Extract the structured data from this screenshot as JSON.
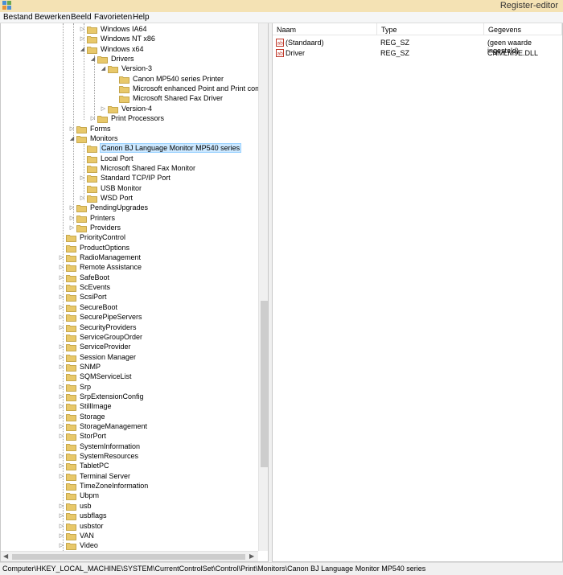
{
  "window": {
    "title": "Register-editor"
  },
  "menu": [
    "Bestand",
    "Bewerken",
    "Beeld",
    "Favorieten",
    "Help"
  ],
  "tree": [
    {
      "label": "Windows IA64",
      "expander": "collapsed"
    },
    {
      "label": "Windows NT x86",
      "expander": "collapsed"
    },
    {
      "label": "Windows x64",
      "expander": "expanded"
    },
    {
      "label": "Drivers",
      "expander": "expanded"
    },
    {
      "label": "Version-3",
      "expander": "expanded"
    },
    {
      "label": "Canon MP540 series Printer",
      "expander": "none"
    },
    {
      "label": "Microsoft enhanced Point and Print compat",
      "expander": "none"
    },
    {
      "label": "Microsoft Shared Fax Driver",
      "expander": "none"
    },
    {
      "label": "Version-4",
      "expander": "collapsed"
    },
    {
      "label": "Print Processors",
      "expander": "collapsed"
    },
    {
      "label": "Forms",
      "expander": "collapsed"
    },
    {
      "label": "Monitors",
      "expander": "expanded"
    },
    {
      "label": "Canon BJ Language Monitor MP540 series",
      "expander": "none",
      "selected": true
    },
    {
      "label": "Local Port",
      "expander": "none"
    },
    {
      "label": "Microsoft Shared Fax Monitor",
      "expander": "none"
    },
    {
      "label": "Standard TCP/IP Port",
      "expander": "collapsed"
    },
    {
      "label": "USB Monitor",
      "expander": "none"
    },
    {
      "label": "WSD Port",
      "expander": "collapsed"
    },
    {
      "label": "PendingUpgrades",
      "expander": "collapsed"
    },
    {
      "label": "Printers",
      "expander": "collapsed"
    },
    {
      "label": "Providers",
      "expander": "collapsed"
    },
    {
      "label": "PriorityControl",
      "expander": "none"
    },
    {
      "label": "ProductOptions",
      "expander": "none"
    },
    {
      "label": "RadioManagement",
      "expander": "collapsed"
    },
    {
      "label": "Remote Assistance",
      "expander": "collapsed"
    },
    {
      "label": "SafeBoot",
      "expander": "collapsed"
    },
    {
      "label": "ScEvents",
      "expander": "collapsed"
    },
    {
      "label": "ScsiPort",
      "expander": "collapsed"
    },
    {
      "label": "SecureBoot",
      "expander": "collapsed"
    },
    {
      "label": "SecurePipeServers",
      "expander": "collapsed"
    },
    {
      "label": "SecurityProviders",
      "expander": "collapsed"
    },
    {
      "label": "ServiceGroupOrder",
      "expander": "none"
    },
    {
      "label": "ServiceProvider",
      "expander": "collapsed"
    },
    {
      "label": "Session Manager",
      "expander": "collapsed"
    },
    {
      "label": "SNMP",
      "expander": "collapsed"
    },
    {
      "label": "SQMServiceList",
      "expander": "none"
    },
    {
      "label": "Srp",
      "expander": "collapsed"
    },
    {
      "label": "SrpExtensionConfig",
      "expander": "collapsed"
    },
    {
      "label": "StillImage",
      "expander": "collapsed"
    },
    {
      "label": "Storage",
      "expander": "collapsed"
    },
    {
      "label": "StorageManagement",
      "expander": "collapsed"
    },
    {
      "label": "StorPort",
      "expander": "collapsed"
    },
    {
      "label": "SystemInformation",
      "expander": "none"
    },
    {
      "label": "SystemResources",
      "expander": "collapsed"
    },
    {
      "label": "TabletPC",
      "expander": "collapsed"
    },
    {
      "label": "Terminal Server",
      "expander": "collapsed"
    },
    {
      "label": "TimeZoneInformation",
      "expander": "none"
    },
    {
      "label": "Ubpm",
      "expander": "none"
    },
    {
      "label": "usb",
      "expander": "collapsed"
    },
    {
      "label": "usbflags",
      "expander": "collapsed"
    },
    {
      "label": "usbstor",
      "expander": "collapsed"
    },
    {
      "label": "VAN",
      "expander": "collapsed"
    },
    {
      "label": "Video",
      "expander": "collapsed"
    }
  ],
  "list": {
    "columns": [
      "Naam",
      "Type",
      "Gegevens"
    ],
    "rows": [
      {
        "name": "(Standaard)",
        "type": "REG_SZ",
        "data": "(geen waarde ingesteld)",
        "icon": "string-value-icon"
      },
      {
        "name": "Driver",
        "type": "REG_SZ",
        "data": "CNMLM9E.DLL",
        "icon": "string-value-icon"
      }
    ]
  },
  "status": {
    "path": "Computer\\HKEY_LOCAL_MACHINE\\SYSTEM\\CurrentControlSet\\Control\\Print\\Monitors\\Canon BJ Language Monitor MP540 series"
  },
  "colors": {
    "titlebar": "#f4e2b4",
    "selection": "#cce8ff",
    "folder": "#e8c86a"
  }
}
